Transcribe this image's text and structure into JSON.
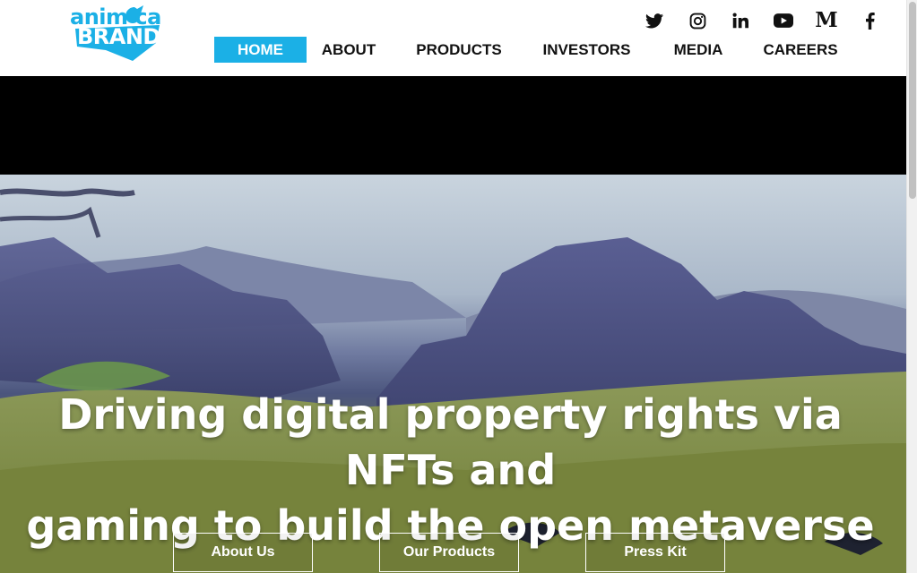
{
  "brand": {
    "logo_line1": "anim  ca",
    "logo_line2": "BRANDS",
    "color": "#1bb0e6"
  },
  "social": [
    "twitter-icon",
    "instagram-icon",
    "linkedin-icon",
    "youtube-icon",
    "medium-icon",
    "facebook-icon"
  ],
  "nav": {
    "items": [
      {
        "label": "HOME",
        "active": true
      },
      {
        "label": "ABOUT"
      },
      {
        "label": "PRODUCTS"
      },
      {
        "label": "INVESTORS"
      },
      {
        "label": "MEDIA"
      },
      {
        "label": "CAREERS"
      }
    ]
  },
  "hero": {
    "headline_line1": "Driving digital property rights via NFTs and",
    "headline_line2": "gaming to build the open metaverse",
    "buttons": [
      {
        "label": "About Us"
      },
      {
        "label": "Our Products"
      },
      {
        "label": "Press Kit"
      }
    ]
  }
}
